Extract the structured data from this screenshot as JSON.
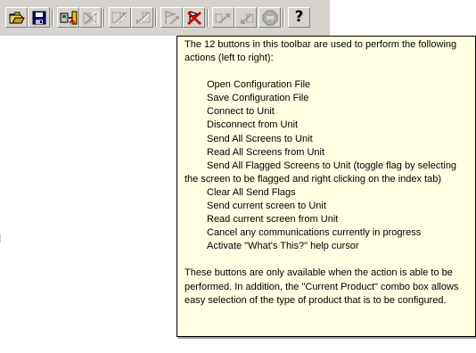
{
  "toolbar": {
    "buttons": [
      {
        "name": "open-configuration-file",
        "icon": "open-folder-icon",
        "enabled": true
      },
      {
        "name": "save-configuration-file",
        "icon": "floppy-disk-icon",
        "enabled": true
      },
      {
        "name": "connect-to-unit",
        "icon": "connect-icon",
        "enabled": true
      },
      {
        "name": "disconnect-from-unit",
        "icon": "disconnect-icon",
        "enabled": false
      },
      {
        "name": "send-all-screens",
        "icon": "send-all-icon",
        "enabled": false
      },
      {
        "name": "read-all-screens",
        "icon": "read-all-icon",
        "enabled": false
      },
      {
        "name": "send-all-flagged-screens",
        "icon": "send-flagged-icon",
        "enabled": false
      },
      {
        "name": "clear-all-send-flags",
        "icon": "clear-flags-icon",
        "enabled": true
      },
      {
        "name": "send-current-screen",
        "icon": "send-current-icon",
        "enabled": false
      },
      {
        "name": "read-current-screen",
        "icon": "read-current-icon",
        "enabled": false
      },
      {
        "name": "cancel-communications",
        "icon": "stop-icon",
        "enabled": false
      },
      {
        "name": "whats-this-help",
        "icon": "help-question-icon",
        "enabled": true,
        "glyph": "?"
      }
    ]
  },
  "tooltip": {
    "intro": "The 12 buttons in this toolbar are used to perform the following\nactions (left to right):",
    "items": [
      {
        "text": "Open Configuration File"
      },
      {
        "text": "Save Configuration File"
      },
      {
        "text": "Connect to Unit"
      },
      {
        "text": "Disconnect from Unit"
      },
      {
        "text": "Send All Screens to Unit"
      },
      {
        "text": "Read All Screens from Unit"
      },
      {
        "text": "Send All Flagged Screens to Unit (toggle flag by selecting",
        "cont": "the screen to be flagged and right clicking on the index tab)"
      },
      {
        "text": "Clear All Send Flags"
      },
      {
        "text": "Send current screen to Unit"
      },
      {
        "text": "Read current screen from Unit"
      },
      {
        "text": "Cancel any communications currently in progress"
      },
      {
        "text": "Activate \"What's This?\" help cursor"
      }
    ],
    "outro": "These buttons are only available when the action is able to be\nperformed. In addition, the \"Current Product\" combo box allows\neasy selection of the type of product that is to be configured."
  },
  "colors": {
    "toolbar_bg": "#d6d3ce",
    "tooltip_bg": "#ffffe1",
    "tooltip_border": "#000000",
    "disabled_icon": "#a0a0a0",
    "accent_red": "#cc0000",
    "accent_yellow": "#f0c000"
  }
}
